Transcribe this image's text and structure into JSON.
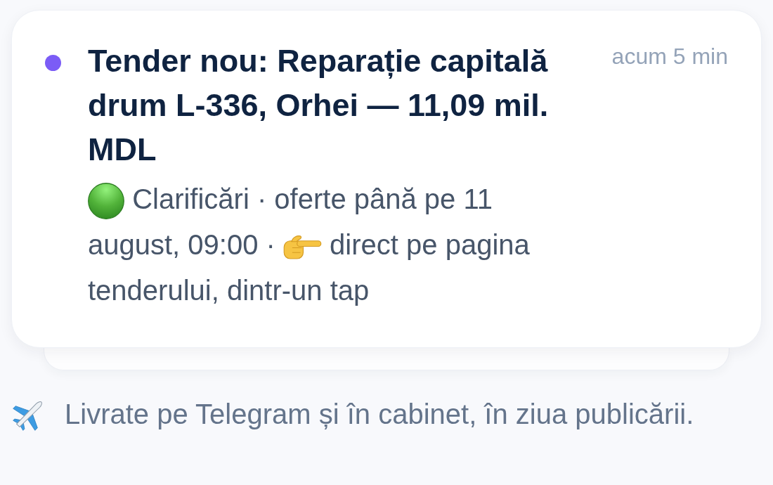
{
  "notification": {
    "unread": true,
    "title": "Tender nou: Reparație capitală drum L-336, Orhei — 11,09 mil. MDL",
    "time": "acum 5 min",
    "body": [
      {
        "kind": "status-dot"
      },
      {
        "kind": "text",
        "text": "Clarificări · oferte până pe 11"
      },
      {
        "kind": "text",
        "text": "august, 09:00 ·"
      },
      {
        "kind": "pointer"
      },
      {
        "kind": "text",
        "text": "direct pe pagina"
      },
      {
        "kind": "text",
        "text": "tenderului, dintr-un tap"
      }
    ],
    "stacked": true
  },
  "footer": {
    "text": "Livrate pe Telegram și în cabinet, în ziua publicării."
  }
}
